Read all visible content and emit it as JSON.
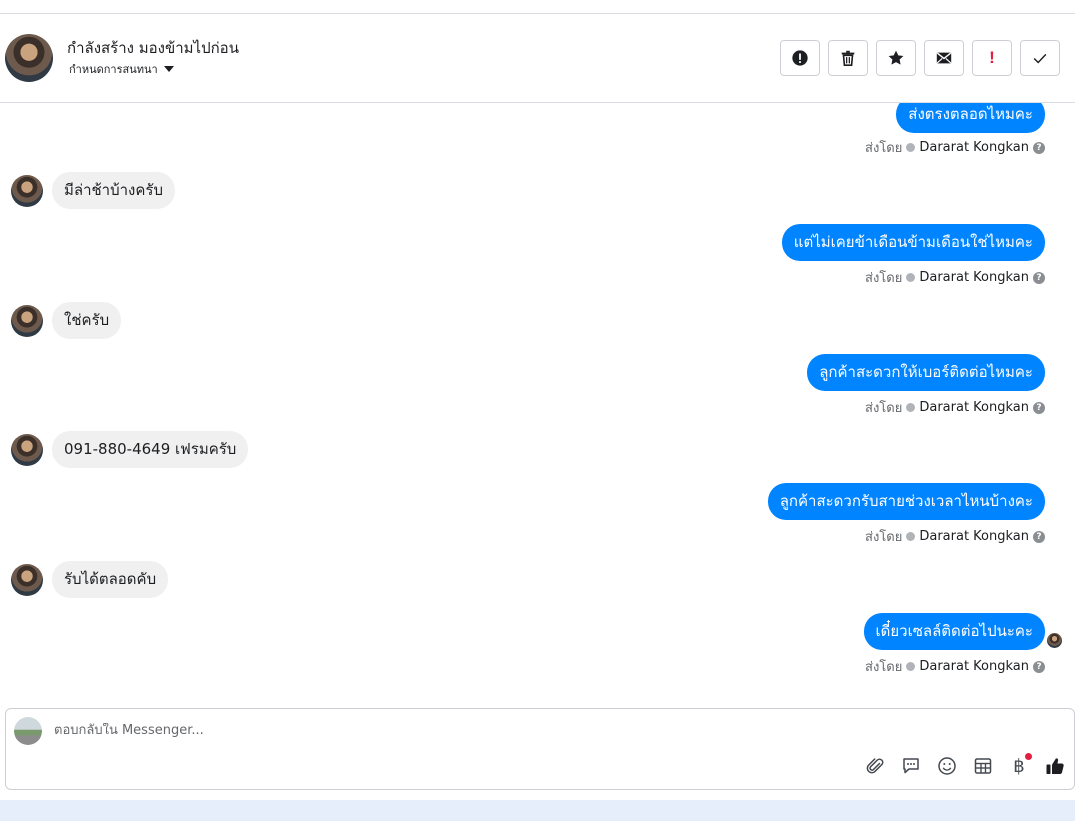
{
  "header": {
    "title": "กำลังสร้าง มองข้ามไปก่อน",
    "subtitle": "กำหนดการสนทนา"
  },
  "messages": {
    "partial_out": {
      "text": "ส่งตรงตลอดไหมคะ",
      "sent_by_label": "ส่งโดย",
      "sender": "Dararat Kongkan"
    },
    "in1": {
      "text": "มีล่าช้าบ้างครับ"
    },
    "out1": {
      "text": "แต่ไม่เคยข้าเดือนข้ามเดือนใช่ไหมคะ",
      "sent_by_label": "ส่งโดย",
      "sender": "Dararat Kongkan"
    },
    "in2": {
      "text": "ใช่ครับ"
    },
    "out2": {
      "text": "ลูกค้าสะดวกให้เบอร์ติดต่อไหมคะ",
      "sent_by_label": "ส่งโดย",
      "sender": "Dararat Kongkan"
    },
    "in3": {
      "text": "091-880-4649 เฟรมครับ"
    },
    "out3": {
      "text": "ลูกค้าสะดวกรับสายช่วงเวลาไหนบ้างคะ",
      "sent_by_label": "ส่งโดย",
      "sender": "Dararat Kongkan"
    },
    "in4": {
      "text": "รับได้ตลอดคับ"
    },
    "out4": {
      "text": "เดี๋ยวเซลล์ติดต่อไปนะคะ",
      "sent_by_label": "ส่งโดย",
      "sender": "Dararat Kongkan"
    }
  },
  "composer": {
    "placeholder": "ตอบกลับใน Messenger...",
    "currency_symbol": "฿"
  },
  "colors": {
    "outgoing_bubble": "#0084ff",
    "incoming_bubble": "#f0f0f0",
    "notification_dot": "#e41e3f"
  }
}
